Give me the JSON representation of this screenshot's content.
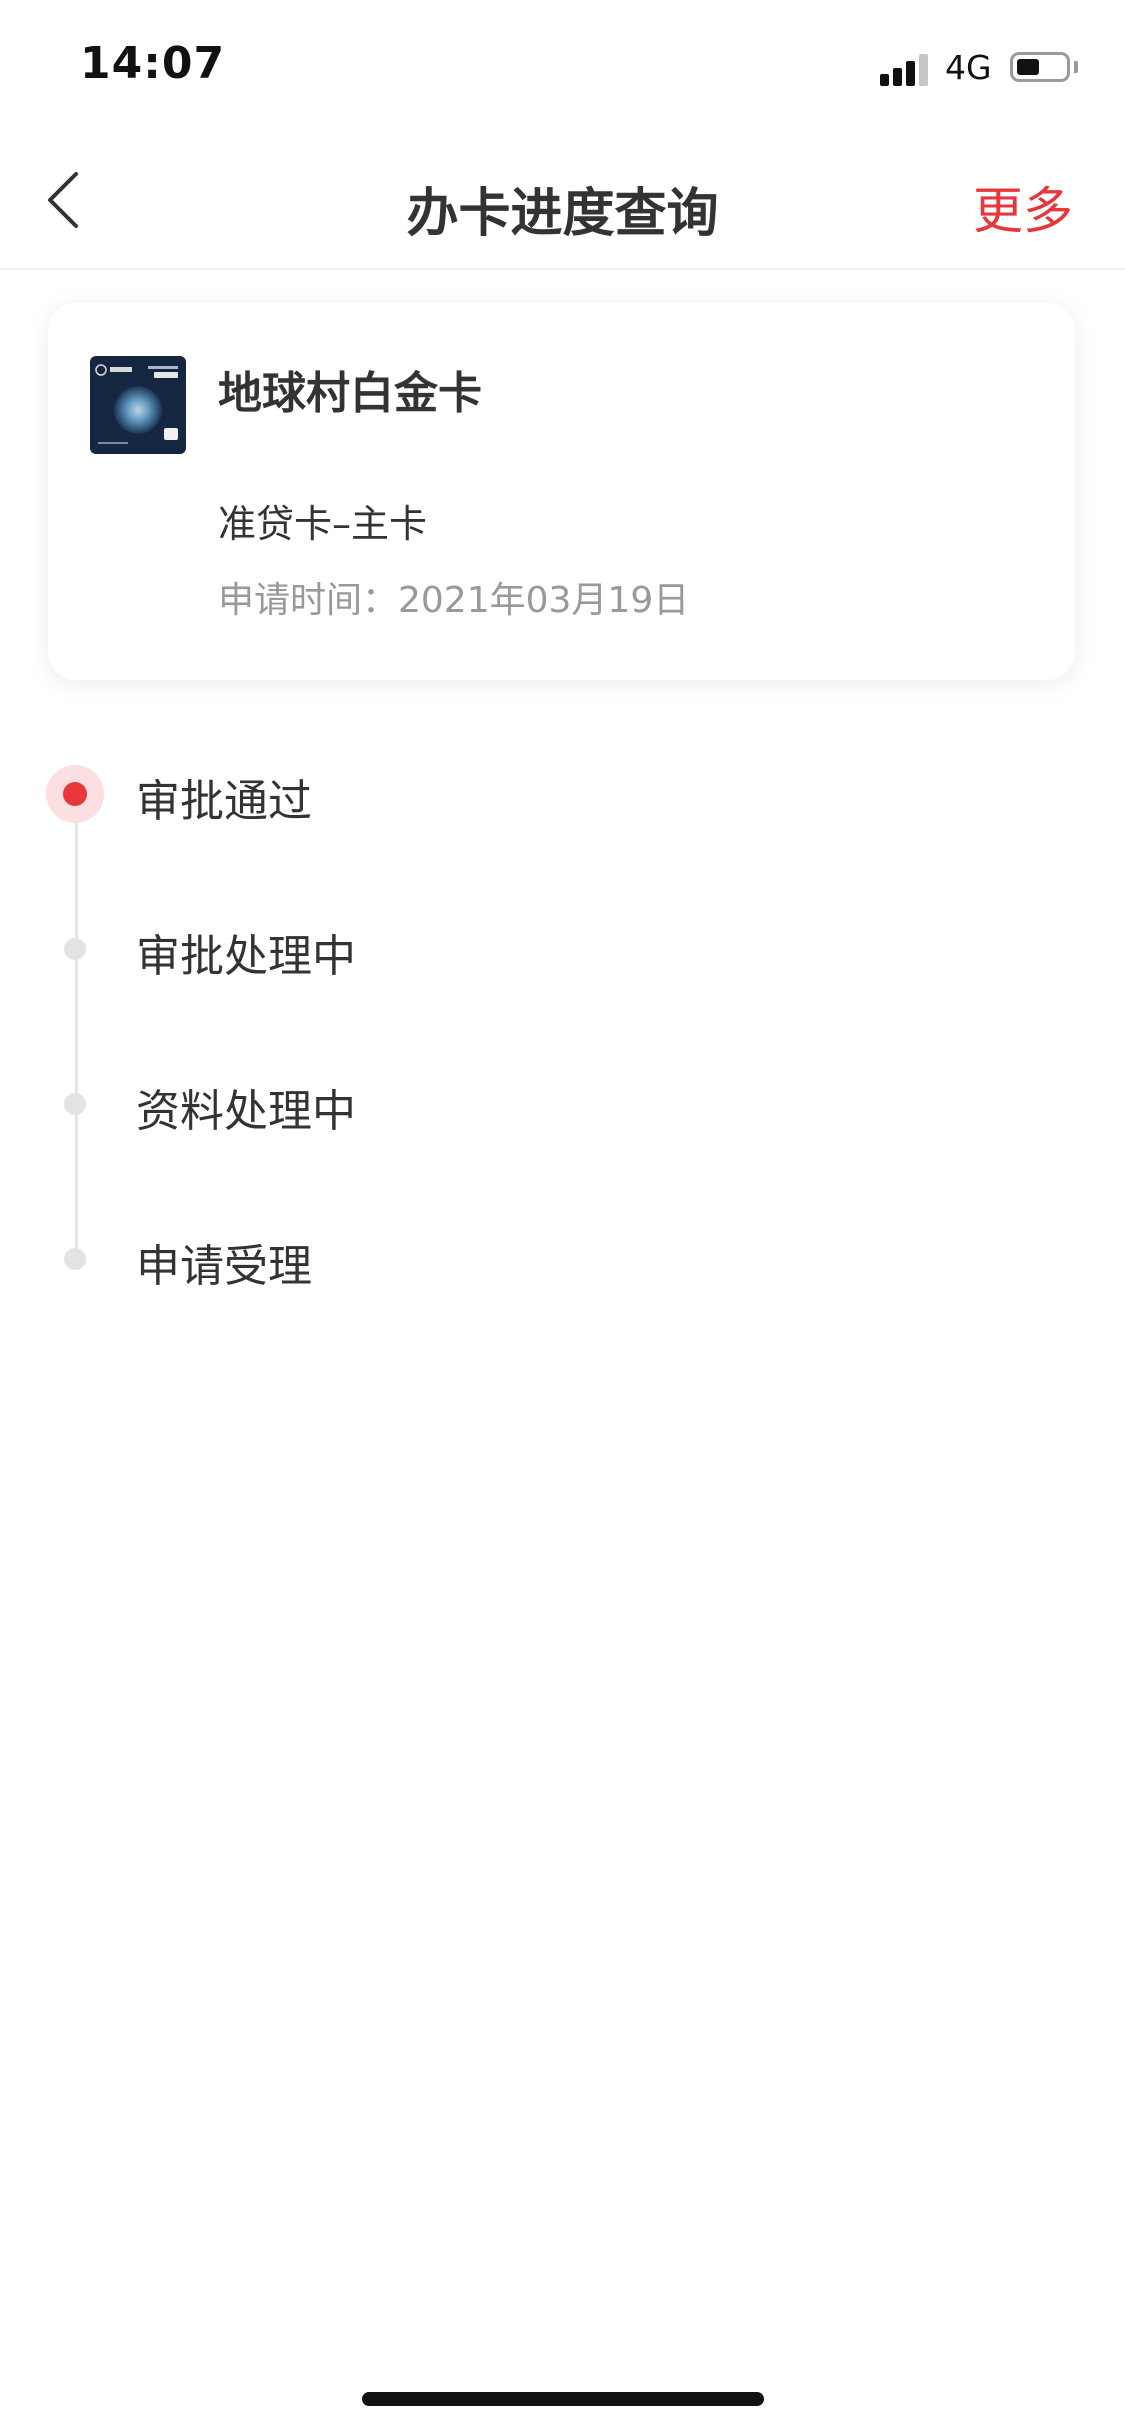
{
  "status_bar": {
    "time": "14:07",
    "network": "4G",
    "signal_level": 3,
    "battery_level": 0.4
  },
  "nav": {
    "title": "办卡进度查询",
    "more_label": "更多"
  },
  "card": {
    "name": "地球村白金卡",
    "type": "准贷卡–主卡",
    "apply_date": "申请时间：2021年03月19日"
  },
  "timeline": {
    "steps": [
      {
        "label": "审批通过",
        "active": true
      },
      {
        "label": "审批处理中",
        "active": false
      },
      {
        "label": "资料处理中",
        "active": false
      },
      {
        "label": "申请受理",
        "active": false
      }
    ]
  },
  "colors": {
    "accent": "#e8373b",
    "text": "#333333",
    "muted": "#999999"
  }
}
